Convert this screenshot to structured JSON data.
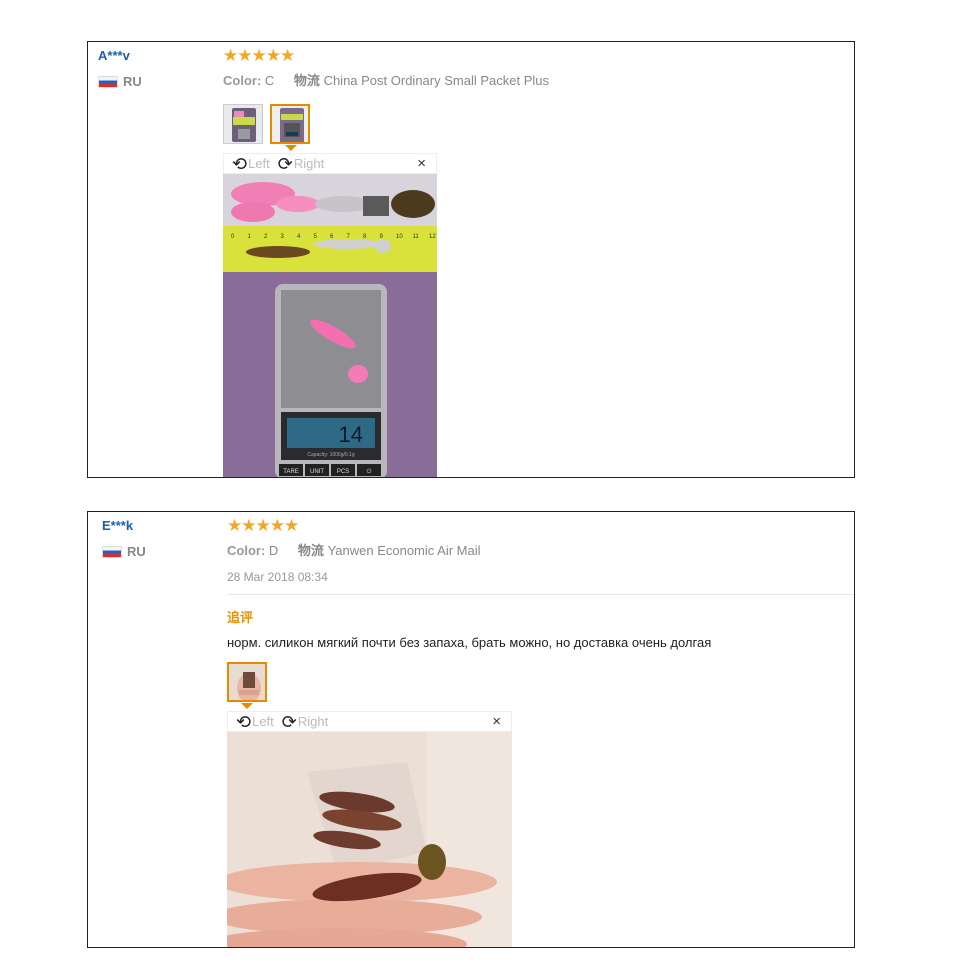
{
  "reviews": [
    {
      "user": "A***v",
      "country": "RU",
      "rating_stars": 5,
      "stars_text": "★★★★★",
      "color_label": "Color:",
      "color_value": "C",
      "shipping_label": "物流",
      "shipping_value": "China Post Ordinary Small Packet Plus",
      "viewer": {
        "left": "Left",
        "right": "Right",
        "close": "×"
      },
      "icons": {
        "rotate_left": "rotate-left-icon",
        "rotate_right": "rotate-right-icon",
        "close": "close-icon"
      },
      "scale_reading": "14",
      "scale_buttons": [
        "TARE",
        "UNIT",
        "PCS",
        "⏻"
      ],
      "scale_capacity": "Capacity: 1000g/0.1g",
      "ruler_numbers": [
        "0",
        "1",
        "2",
        "3",
        "4",
        "5",
        "6",
        "7",
        "8",
        "9",
        "10",
        "11",
        "12"
      ]
    },
    {
      "user": "E***k",
      "country": "RU",
      "rating_stars": 5,
      "stars_text": "★★★★★",
      "color_label": "Color:",
      "color_value": "D",
      "shipping_label": "物流",
      "shipping_value": "Yanwen Economic Air Mail",
      "date": "28 Mar 2018 08:34",
      "append_label": "追评",
      "text": "норм. силикон мягкий почти без запаха, брать можно, но доставка очень долгая",
      "viewer": {
        "left": "Left",
        "right": "Right",
        "close": "×"
      }
    }
  ],
  "colors": {
    "user": "#1a5fb4",
    "stars": "#f5a623",
    "accent": "#e68a00"
  }
}
